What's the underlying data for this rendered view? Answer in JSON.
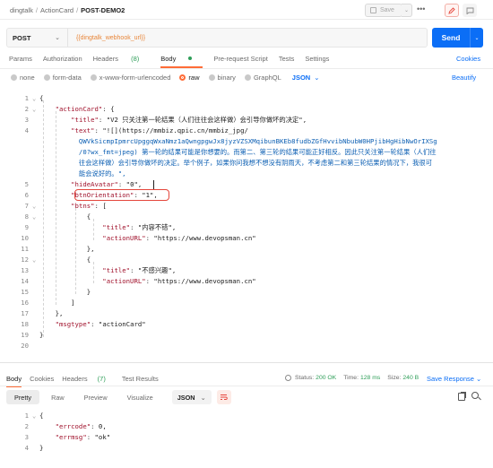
{
  "breadcrumb": {
    "workspace": "dingtalk",
    "collection": "ActionCard",
    "request": "POST-DEMO2"
  },
  "toolbar": {
    "save_label": "Save",
    "more_label": "•••"
  },
  "request": {
    "method": "POST",
    "url": "{{dingtalk_webhook_url}}",
    "send_label": "Send"
  },
  "tabs": {
    "params": "Params",
    "authorization": "Authorization",
    "headers": "Headers",
    "headers_count": "(8)",
    "body": "Body",
    "prerequest": "Pre-request Script",
    "tests": "Tests",
    "settings": "Settings",
    "cookies": "Cookies"
  },
  "body_types": {
    "none": "none",
    "form_data": "form-data",
    "urlencoded": "x-www-form-urlencoded",
    "raw": "raw",
    "binary": "binary",
    "graphql": "GraphQL",
    "format": "JSON",
    "beautify": "Beautify"
  },
  "editor_lines": [
    {
      "n": "1",
      "fold": "⌄",
      "text": "{"
    },
    {
      "n": "2",
      "fold": "⌄",
      "text": "    \"actionCard\": {"
    },
    {
      "n": "3",
      "fold": "",
      "text": "        \"title\": \"V2 只关注第一轮结果（人们往往会这样做）会引导你做坏的决定\","
    },
    {
      "n": "4",
      "fold": "",
      "text": "        \"text\": \"![](https://mmbiz.qpic.cn/mmbiz_jpg/"
    },
    {
      "n": "",
      "fold": "",
      "text": "          QWVkSicmpIpmrcUpggqWxaNmz1aQwngpgwJx8jyzVZSXMqibunBKEb8fudbZGfHvvibNbubW0HPjibHgHibNwOrIXSg"
    },
    {
      "n": "",
      "fold": "",
      "text": "          /0?wx_fmt=jpeg) 第一轮的结果可能是你想要的。而第二、第三轮的结果可能正好相反。因此只关注第一轮结果（人们往"
    },
    {
      "n": "",
      "fold": "",
      "text": "          往会这样做）会引导你做坏的决定。举个例子，如果你问我想不想没有阴雨天，不考虑第二和第三轮结果的情况下，我很可"
    },
    {
      "n": "",
      "fold": "",
      "text": "          能会说好的。\","
    },
    {
      "n": "5",
      "fold": "",
      "text": "        \"hideAvatar\": \"0\","
    },
    {
      "n": "6",
      "fold": "",
      "text": "        \"btnOrientation\": \"1\","
    },
    {
      "n": "7",
      "fold": "⌄",
      "text": "        \"btns\": ["
    },
    {
      "n": "8",
      "fold": "⌄",
      "text": "            {"
    },
    {
      "n": "9",
      "fold": "",
      "text": "                \"title\": \"内容不错\","
    },
    {
      "n": "10",
      "fold": "",
      "text": "                \"actionURL\": \"https://www.devopsman.cn\""
    },
    {
      "n": "11",
      "fold": "",
      "text": "            },"
    },
    {
      "n": "12",
      "fold": "⌄",
      "text": "            {"
    },
    {
      "n": "13",
      "fold": "",
      "text": "                \"title\": \"不感兴趣\","
    },
    {
      "n": "14",
      "fold": "",
      "text": "                \"actionURL\": \"https://www.devopsman.cn\""
    },
    {
      "n": "15",
      "fold": "",
      "text": "            }"
    },
    {
      "n": "16",
      "fold": "",
      "text": "        ]"
    },
    {
      "n": "17",
      "fold": "",
      "text": "    },"
    },
    {
      "n": "18",
      "fold": "",
      "text": "    \"msgtype\": \"actionCard\""
    },
    {
      "n": "19",
      "fold": "",
      "text": "}"
    },
    {
      "n": "20",
      "fold": "",
      "text": ""
    }
  ],
  "response": {
    "tabs": {
      "body": "Body",
      "cookies": "Cookies",
      "headers": "Headers",
      "headers_count": "(7)",
      "test_results": "Test Results"
    },
    "status_label": "Status:",
    "status_value": "200 OK",
    "time_label": "Time:",
    "time_value": "128 ms",
    "size_label": "Size:",
    "size_value": "240 B",
    "save_response": "Save Response",
    "view_modes": {
      "pretty": "Pretty",
      "raw": "Raw",
      "preview": "Preview",
      "visualize": "Visualize"
    },
    "format": "JSON",
    "lines": [
      {
        "n": "1",
        "fold": "⌄",
        "text": "{"
      },
      {
        "n": "2",
        "fold": "",
        "text": "    \"errcode\": 0,"
      },
      {
        "n": "3",
        "fold": "",
        "text": "    \"errmsg\": \"ok\""
      },
      {
        "n": "4",
        "fold": "",
        "text": "}"
      }
    ]
  }
}
